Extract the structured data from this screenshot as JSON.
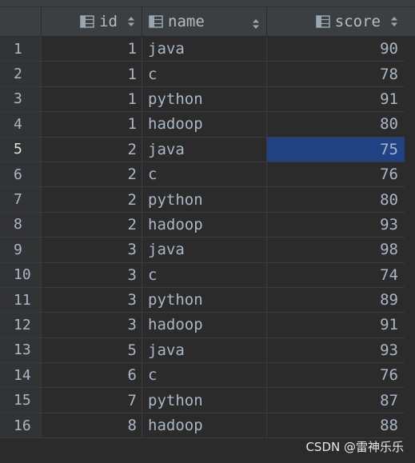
{
  "columns": {
    "id": "id",
    "name": "name",
    "score": "score"
  },
  "rows": [
    {
      "n": "1",
      "id": "1",
      "name": "java",
      "score": "90"
    },
    {
      "n": "2",
      "id": "1",
      "name": "c",
      "score": "78"
    },
    {
      "n": "3",
      "id": "1",
      "name": "python",
      "score": "91"
    },
    {
      "n": "4",
      "id": "1",
      "name": "hadoop",
      "score": "80"
    },
    {
      "n": "5",
      "id": "2",
      "name": "java",
      "score": "75"
    },
    {
      "n": "6",
      "id": "2",
      "name": "c",
      "score": "76"
    },
    {
      "n": "7",
      "id": "2",
      "name": "python",
      "score": "80"
    },
    {
      "n": "8",
      "id": "2",
      "name": "hadoop",
      "score": "93"
    },
    {
      "n": "9",
      "id": "3",
      "name": "java",
      "score": "98"
    },
    {
      "n": "10",
      "id": "3",
      "name": "c",
      "score": "74"
    },
    {
      "n": "11",
      "id": "3",
      "name": "python",
      "score": "89"
    },
    {
      "n": "12",
      "id": "3",
      "name": "hadoop",
      "score": "91"
    },
    {
      "n": "13",
      "id": "5",
      "name": "java",
      "score": "93"
    },
    {
      "n": "14",
      "id": "6",
      "name": "c",
      "score": "76"
    },
    {
      "n": "15",
      "id": "7",
      "name": "python",
      "score": "87"
    },
    {
      "n": "16",
      "id": "8",
      "name": "hadoop",
      "score": "88"
    }
  ],
  "selection": {
    "row": 4,
    "column": "score"
  },
  "watermark": "CSDN @雷神乐乐",
  "icons": {
    "column": "table-column-icon",
    "sort": "sort-arrows-icon"
  },
  "colors": {
    "background": "#2b2b2b",
    "header": "#3c3f41",
    "selected_cell": "#214283",
    "text": "#a9b7c6"
  }
}
